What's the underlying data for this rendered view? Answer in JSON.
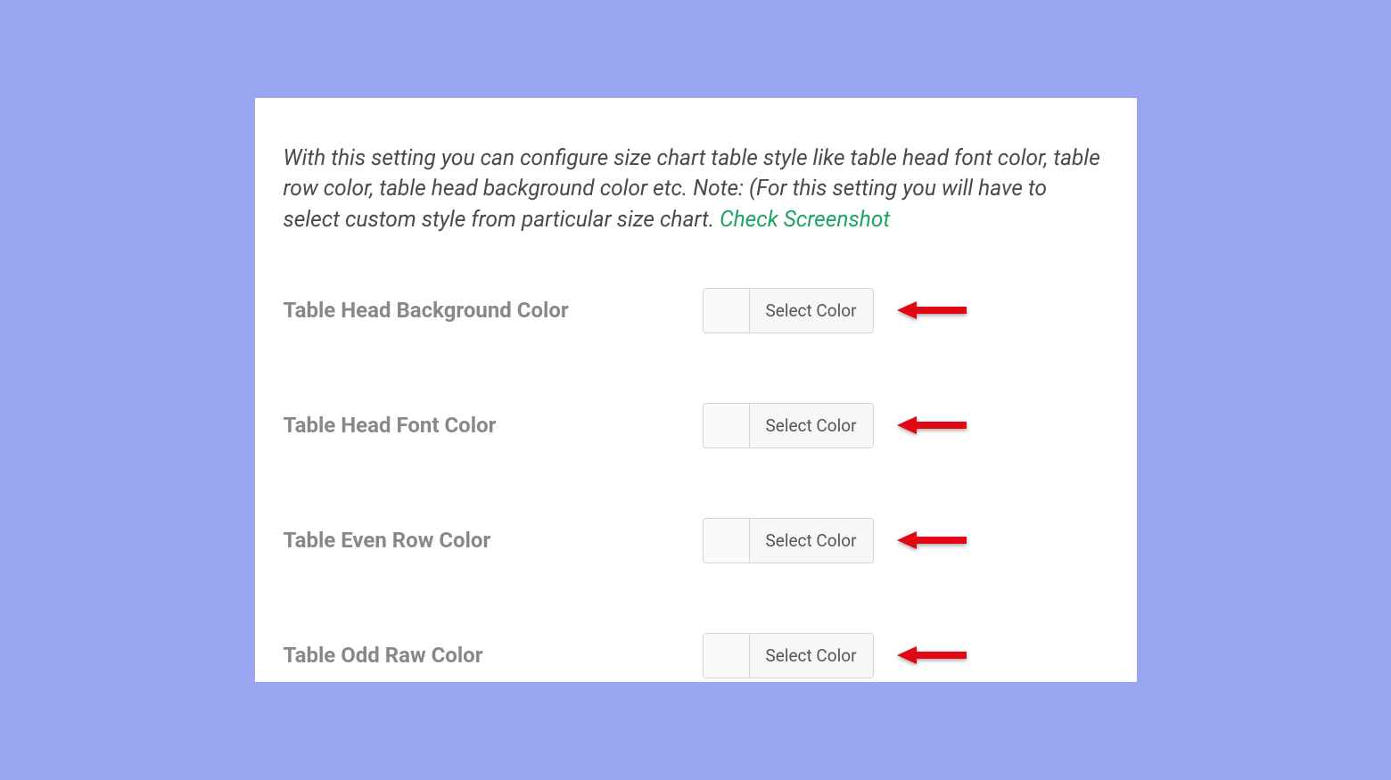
{
  "description": {
    "text": "With this setting you can configure size chart table style like table head font color, table row color, table head background color etc. Note: (For this setting you will have to select custom style from particular size chart. ",
    "link": "Check Screenshot"
  },
  "fields": [
    {
      "label": "Table Head Background Color",
      "button": "Select Color"
    },
    {
      "label": "Table Head Font Color",
      "button": "Select Color"
    },
    {
      "label": "Table Even Row Color",
      "button": "Select Color"
    },
    {
      "label": "Table Odd Raw Color",
      "button": "Select Color"
    }
  ],
  "colors": {
    "background": "#9aa6f2",
    "panel": "#ffffff",
    "link": "#1ba462",
    "label": "#888888",
    "arrow": "#e30613"
  }
}
